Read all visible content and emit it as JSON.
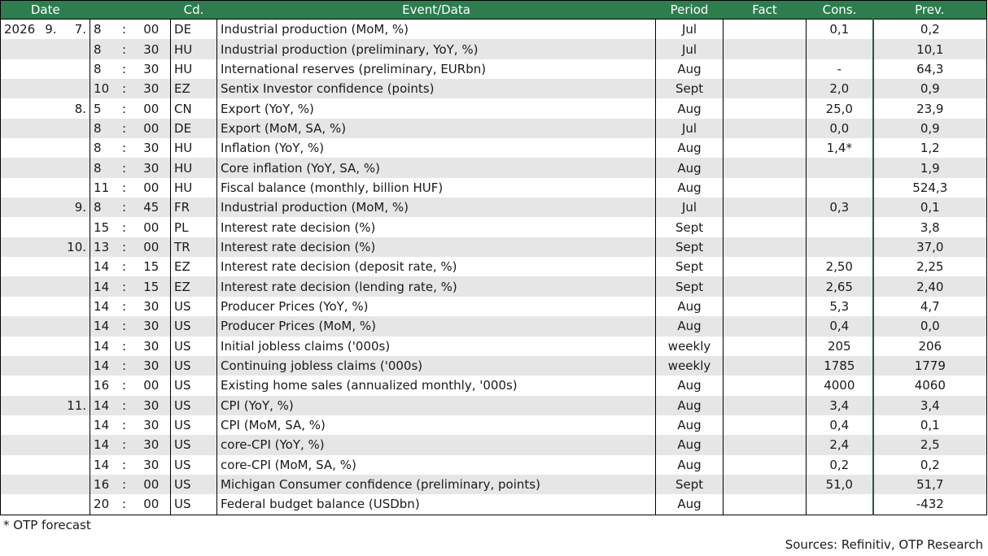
{
  "header": {
    "date": "Date",
    "cd": "Cd.",
    "event": "Event/Data",
    "period": "Period",
    "fact": "Fact",
    "cons": "Cons.",
    "prev": "Prev."
  },
  "rows": [
    {
      "year": "2026",
      "month": "9.",
      "day": "7.",
      "hh": "8",
      "mm": "00",
      "cd": "DE",
      "event": "Industrial production (MoM, %)",
      "period": "Jul",
      "fact": "",
      "cons": "0,1",
      "prev": "0,2"
    },
    {
      "year": "",
      "month": "",
      "day": "",
      "hh": "8",
      "mm": "30",
      "cd": "HU",
      "event": "Industrial production (preliminary, YoY, %)",
      "period": "Jul",
      "fact": "",
      "cons": "",
      "prev": "10,1"
    },
    {
      "year": "",
      "month": "",
      "day": "",
      "hh": "8",
      "mm": "30",
      "cd": "HU",
      "event": "International reserves (preliminary, EURbn)",
      "period": "Aug",
      "fact": "",
      "cons": "-",
      "prev": "64,3"
    },
    {
      "year": "",
      "month": "",
      "day": "",
      "hh": "10",
      "mm": "30",
      "cd": "EZ",
      "event": "Sentix Investor confidence (points)",
      "period": "Sept",
      "fact": "",
      "cons": "2,0",
      "prev": "0,9"
    },
    {
      "year": "",
      "month": "",
      "day": "8.",
      "hh": "5",
      "mm": "00",
      "cd": "CN",
      "event": "Export (YoY, %)",
      "period": "Aug",
      "fact": "",
      "cons": "25,0",
      "prev": "23,9"
    },
    {
      "year": "",
      "month": "",
      "day": "",
      "hh": "8",
      "mm": "00",
      "cd": "DE",
      "event": "Export (MoM, SA, %)",
      "period": "Jul",
      "fact": "",
      "cons": "0,0",
      "prev": "0,9"
    },
    {
      "year": "",
      "month": "",
      "day": "",
      "hh": "8",
      "mm": "30",
      "cd": "HU",
      "event": "Inflation (YoY, %)",
      "period": "Aug",
      "fact": "",
      "cons": "1,4*",
      "prev": "1,2"
    },
    {
      "year": "",
      "month": "",
      "day": "",
      "hh": "8",
      "mm": "30",
      "cd": "HU",
      "event": "Core inflation (YoY, SA, %)",
      "period": "Aug",
      "fact": "",
      "cons": "",
      "prev": "1,9"
    },
    {
      "year": "",
      "month": "",
      "day": "",
      "hh": "11",
      "mm": "00",
      "cd": "HU",
      "event": "Fiscal balance (monthly, billion HUF)",
      "period": "Aug",
      "fact": "",
      "cons": "",
      "prev": "524,3"
    },
    {
      "year": "",
      "month": "",
      "day": "9.",
      "hh": "8",
      "mm": "45",
      "cd": "FR",
      "event": "Industrial production (MoM, %)",
      "period": "Jul",
      "fact": "",
      "cons": "0,3",
      "prev": "0,1"
    },
    {
      "year": "",
      "month": "",
      "day": "",
      "hh": "15",
      "mm": "00",
      "cd": "PL",
      "event": "Interest rate decision (%)",
      "period": "Sept",
      "fact": "",
      "cons": "",
      "prev": "3,8"
    },
    {
      "year": "",
      "month": "",
      "day": "10.",
      "hh": "13",
      "mm": "00",
      "cd": "TR",
      "event": "Interest rate decision (%)",
      "period": "Sept",
      "fact": "",
      "cons": "",
      "prev": "37,0"
    },
    {
      "year": "",
      "month": "",
      "day": "",
      "hh": "14",
      "mm": "15",
      "cd": "EZ",
      "event": "Interest rate decision (deposit rate, %)",
      "period": "Sept",
      "fact": "",
      "cons": "2,50",
      "prev": "2,25"
    },
    {
      "year": "",
      "month": "",
      "day": "",
      "hh": "14",
      "mm": "15",
      "cd": "EZ",
      "event": "Interest rate decision (lending rate, %)",
      "period": "Sept",
      "fact": "",
      "cons": "2,65",
      "prev": "2,40"
    },
    {
      "year": "",
      "month": "",
      "day": "",
      "hh": "14",
      "mm": "30",
      "cd": "US",
      "event": "Producer Prices (YoY, %)",
      "period": "Aug",
      "fact": "",
      "cons": "5,3",
      "prev": "4,7"
    },
    {
      "year": "",
      "month": "",
      "day": "",
      "hh": "14",
      "mm": "30",
      "cd": "US",
      "event": "Producer Prices (MoM, %)",
      "period": "Aug",
      "fact": "",
      "cons": "0,4",
      "prev": "0,0"
    },
    {
      "year": "",
      "month": "",
      "day": "",
      "hh": "14",
      "mm": "30",
      "cd": "US",
      "event": "Initial jobless claims ('000s)",
      "period": "weekly",
      "fact": "",
      "cons": "205",
      "prev": "206"
    },
    {
      "year": "",
      "month": "",
      "day": "",
      "hh": "14",
      "mm": "30",
      "cd": "US",
      "event": "Continuing jobless claims ('000s)",
      "period": "weekly",
      "fact": "",
      "cons": "1785",
      "prev": "1779"
    },
    {
      "year": "",
      "month": "",
      "day": "",
      "hh": "16",
      "mm": "00",
      "cd": "US",
      "event": "Existing home sales (annualized monthly, '000s)",
      "period": "Aug",
      "fact": "",
      "cons": "4000",
      "prev": "4060"
    },
    {
      "year": "",
      "month": "",
      "day": "11.",
      "hh": "14",
      "mm": "30",
      "cd": "US",
      "event": "CPI (YoY, %)",
      "period": "Aug",
      "fact": "",
      "cons": "3,4",
      "prev": "3,4"
    },
    {
      "year": "",
      "month": "",
      "day": "",
      "hh": "14",
      "mm": "30",
      "cd": "US",
      "event": "CPI (MoM, SA, %)",
      "period": "Aug",
      "fact": "",
      "cons": "0,4",
      "prev": "0,1"
    },
    {
      "year": "",
      "month": "",
      "day": "",
      "hh": "14",
      "mm": "30",
      "cd": "US",
      "event": "core-CPI (YoY, %)",
      "period": "Aug",
      "fact": "",
      "cons": "2,4",
      "prev": "2,5"
    },
    {
      "year": "",
      "month": "",
      "day": "",
      "hh": "14",
      "mm": "30",
      "cd": "US",
      "event": "core-CPI (MoM, SA, %)",
      "period": "Aug",
      "fact": "",
      "cons": "0,2",
      "prev": "0,2"
    },
    {
      "year": "",
      "month": "",
      "day": "",
      "hh": "16",
      "mm": "00",
      "cd": "US",
      "event": "Michigan Consumer confidence (preliminary, points)",
      "period": "Sept",
      "fact": "",
      "cons": "51,0",
      "prev": "51,7"
    },
    {
      "year": "",
      "month": "",
      "day": "",
      "hh": "20",
      "mm": "00",
      "cd": "US",
      "event": "Federal budget balance (USDbn)",
      "period": "Aug",
      "fact": "",
      "cons": "",
      "prev": "-432"
    }
  ],
  "footnote": "* OTP forecast",
  "sources": "Sources: Refinitiv, OTP Research"
}
